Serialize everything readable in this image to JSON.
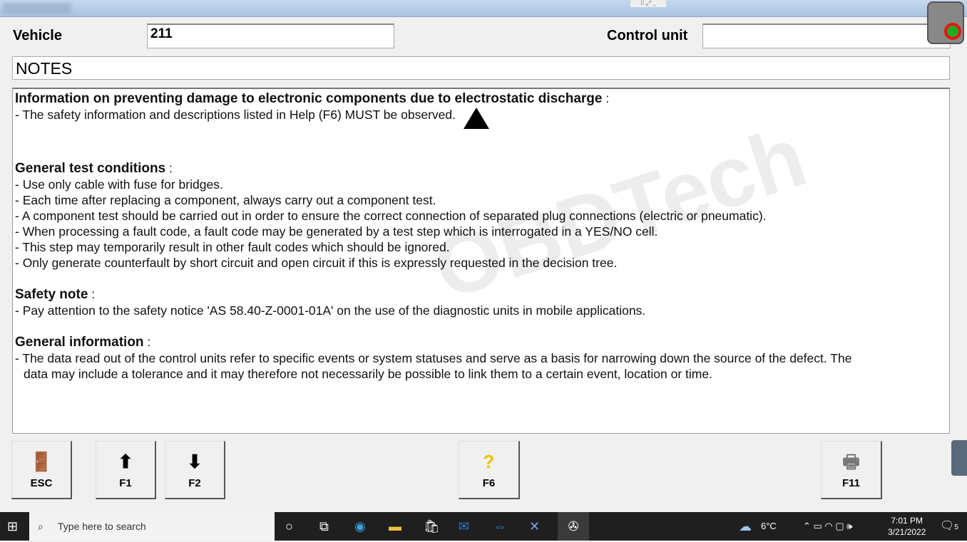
{
  "header": {
    "vehicle_label": "Vehicle",
    "vehicle_value": "211",
    "control_unit_label": "Control unit",
    "control_unit_value": ""
  },
  "notes_title": "NOTES",
  "content": {
    "s1_title": "Information on preventing damage to electronic components due to electrostatic discharge",
    "s1_lines": [
      "- The safety information and descriptions listed in Help (F6) MUST be observed."
    ],
    "s2_title": "General test conditions",
    "s2_lines": [
      "- Use only cable with fuse for bridges.",
      "- Each time after replacing a component, always carry out a component test.",
      "- A component test should be carried out in order to ensure the correct connection of separated plug connections (electric or pneumatic).",
      "- When processing a fault code, a fault code may be generated by a test step which is interrogated in a YES/NO cell.",
      "- This step may temporarily result in other fault codes which should be ignored.",
      "- Only generate counterfault by short circuit and open circuit if this is expressly requested in the decision tree."
    ],
    "s3_title": "Safety note",
    "s3_lines": [
      "- Pay attention to the safety notice 'AS 58.40-Z-0001-01A' on the use of the diagnostic units in mobile applications."
    ],
    "s4_title": "General information",
    "s4_line1": "- The data read out of the control units refer to specific events or system statuses and serve as a basis for narrowing down the source of the defect. The",
    "s4_line2": "data may include a tolerance and it may therefore not necessarily be possible to link them to a certain event, location or time."
  },
  "watermark": "OBDTech",
  "buttons": {
    "esc": "ESC",
    "f1": "F1",
    "f2": "F2",
    "f6": "F6",
    "f11": "F11"
  },
  "taskbar": {
    "search_placeholder": "Type here to search",
    "weather": "6°C",
    "time": "7:01 PM",
    "date": "3/21/2022",
    "notifications": "5"
  }
}
